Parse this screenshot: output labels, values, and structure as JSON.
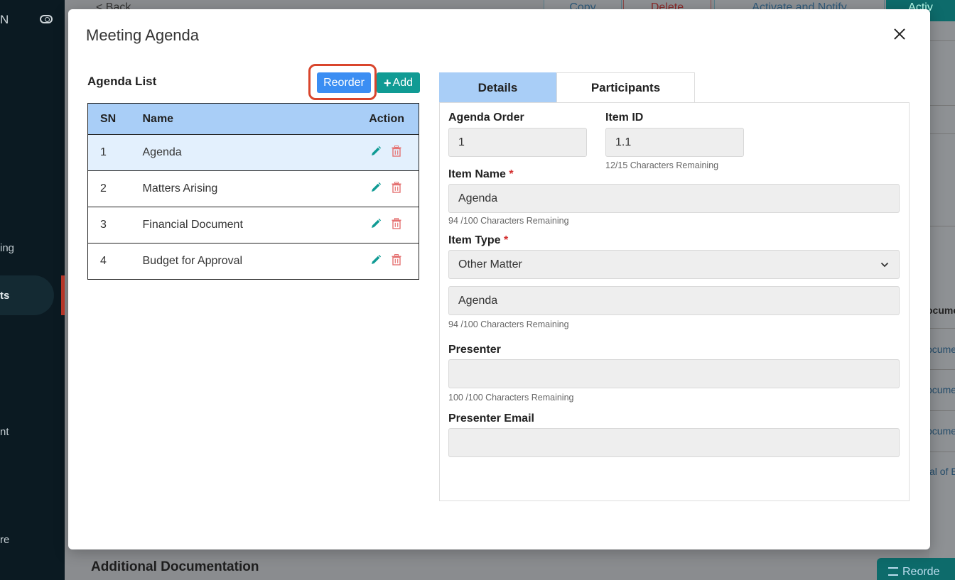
{
  "background": {
    "sidebar": {
      "brand": "N",
      "items": [
        "ing",
        "ts",
        "nt",
        "re"
      ]
    },
    "topbar": {
      "back": "< Back",
      "buttons": [
        "Copy",
        "Delete",
        "Activate and Notify",
        "Activ"
      ]
    },
    "right_column": [
      "ocume",
      "ocume",
      "ocume",
      "ocume",
      "al of E"
    ],
    "bottom_title": "Additional Documentation",
    "bottom_button": "Reorde"
  },
  "modal": {
    "title": "Meeting Agenda",
    "agenda_list": {
      "heading": "Agenda List",
      "reorder_label": "Reorder",
      "add_label": "Add",
      "columns": {
        "sn": "SN",
        "name": "Name",
        "action": "Action"
      },
      "rows": [
        {
          "sn": "1",
          "name": "Agenda"
        },
        {
          "sn": "2",
          "name": "Matters Arising"
        },
        {
          "sn": "3",
          "name": "Financial Document"
        },
        {
          "sn": "4",
          "name": "Budget for Approval"
        }
      ],
      "selected_index": 0
    },
    "tabs": {
      "details": "Details",
      "participants": "Participants",
      "active": "details"
    },
    "form": {
      "agenda_order_label": "Agenda Order",
      "agenda_order_value": "1",
      "item_id_label": "Item ID",
      "item_id_value": "1.1",
      "item_id_hint": "12/15 Characters Remaining",
      "item_name_label": "Item Name",
      "item_name_value": "Agenda",
      "item_name_hint": "94 /100 Characters Remaining",
      "item_type_label": "Item Type",
      "item_type_value": "Other Matter",
      "item_type_detail_value": "Agenda",
      "item_type_detail_hint": "94 /100 Characters Remaining",
      "presenter_label": "Presenter",
      "presenter_value": "",
      "presenter_hint": "100 /100 Characters Remaining",
      "presenter_email_label": "Presenter Email",
      "presenter_email_value": "",
      "required_mark": "*"
    }
  },
  "colors": {
    "accent_blue": "#3b8ef3",
    "teal": "#109b94",
    "header_blue": "#a9cef7",
    "highlight_red": "#d9452c",
    "delete_red": "#e57373"
  }
}
